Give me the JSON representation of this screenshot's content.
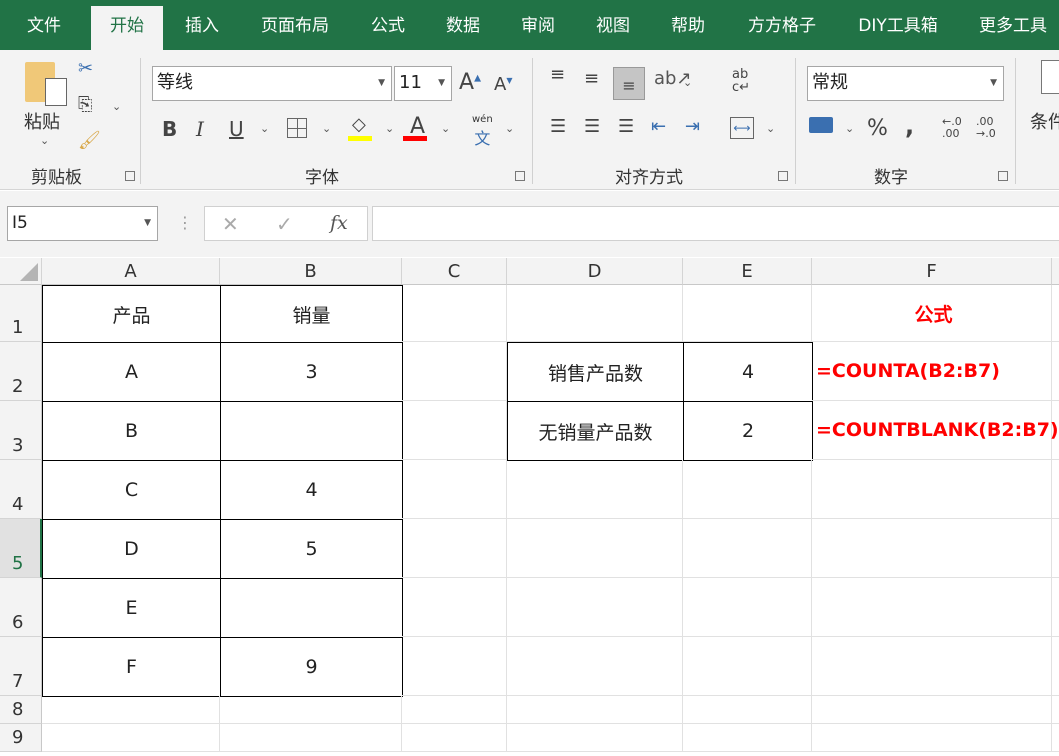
{
  "tabs": [
    "文件",
    "开始",
    "插入",
    "页面布局",
    "公式",
    "数据",
    "审阅",
    "视图",
    "帮助",
    "方方格子",
    "DIY工具箱",
    "更多工具"
  ],
  "ribbon": {
    "paste": "粘贴",
    "clipboard": "剪贴板",
    "font_name": "等线",
    "font_size": "11",
    "font_group": "字体",
    "align_group": "对齐方式",
    "number_format": "常规",
    "number_group": "数字",
    "cond": "条件",
    "wen": "wén",
    "wen_char": "文",
    "bold": "B",
    "italic": "I",
    "underline": "U",
    "percent": "%",
    "comma": ",",
    "dec_inc": "←.0 .00",
    "dec_dec": ".00 →.0",
    "wrap": "ab c↵"
  },
  "formula_bar": {
    "name_box": "I5",
    "cancel": "✕",
    "enter": "✓",
    "fx": "fx",
    "value": ""
  },
  "columns": [
    "A",
    "B",
    "C",
    "D",
    "E",
    "F"
  ],
  "rows": [
    "1",
    "2",
    "3",
    "4",
    "5",
    "6",
    "7",
    "8",
    "9"
  ],
  "cells": {
    "A1": "产品",
    "B1": "销量",
    "A2": "A",
    "B2": "3",
    "A3": "B",
    "B3": "",
    "A4": "C",
    "B4": "4",
    "A5": "D",
    "B5": "5",
    "A6": "E",
    "B6": "",
    "A7": "F",
    "B7": "9",
    "D2": "销售产品数",
    "E2": "4",
    "D3": "无销量产品数",
    "E3": "2",
    "F1": "公式",
    "F2": "=COUNTA(B2:B7)",
    "F3": "=COUNTBLANK(B2:B7)"
  },
  "colors": {
    "accent": "#217346",
    "formula": "#ff0000"
  }
}
